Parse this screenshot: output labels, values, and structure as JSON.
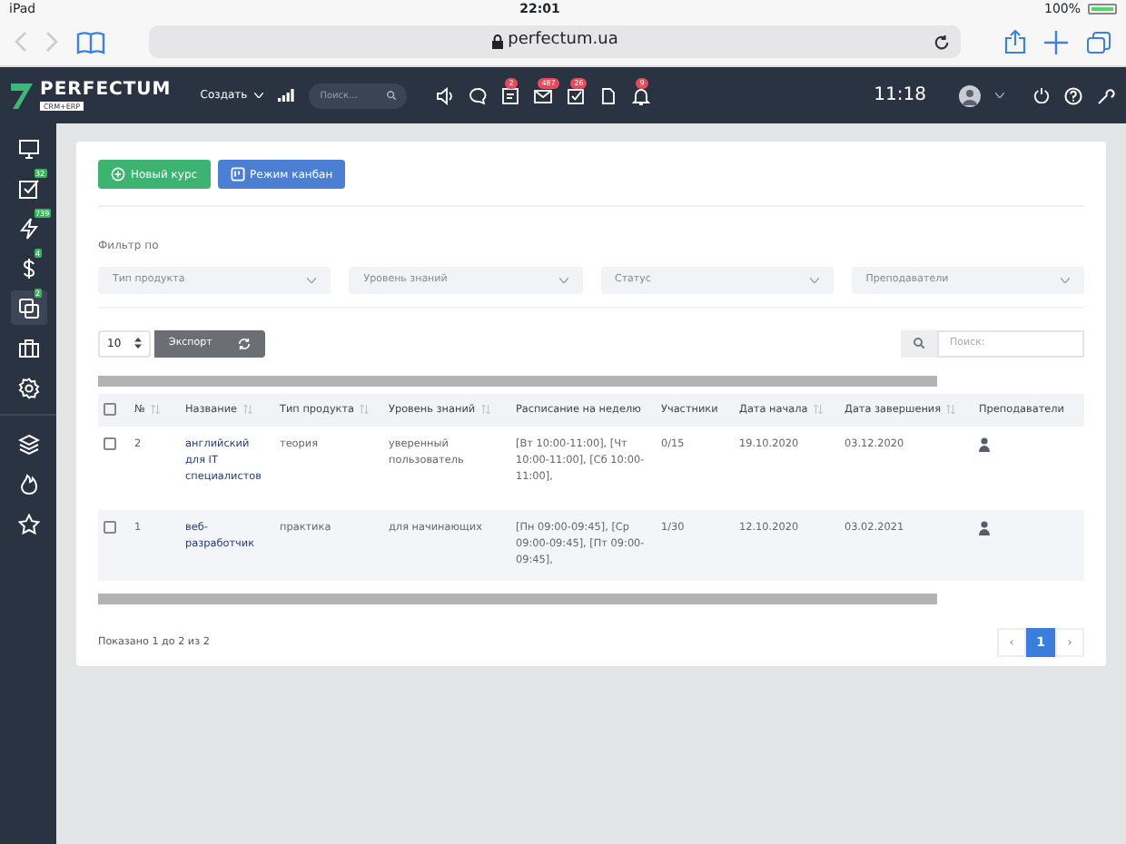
{
  "status_bar": {
    "device": "iPad",
    "time": "22:01",
    "battery": "100%"
  },
  "browser": {
    "url": "perfectum.ua"
  },
  "app_header": {
    "logo": "PERFECTUM",
    "logo_sub": "CRM+ERP",
    "create_menu": "Создать",
    "search": {
      "placeholder": "Поиск..."
    },
    "tools": [
      {
        "kind": "volume"
      },
      {
        "kind": "chat"
      },
      {
        "kind": "inbox",
        "badge": "2"
      },
      {
        "kind": "mail",
        "badge": "487"
      },
      {
        "kind": "tasks",
        "badge": "26"
      },
      {
        "kind": "document"
      },
      {
        "kind": "bell",
        "badge": "9"
      }
    ],
    "clock": "11:18"
  },
  "sidebar": {
    "groups": [
      [
        {
          "kind": "monitor",
          "selected": false
        },
        {
          "kind": "tasks",
          "badge": "32",
          "selected": false
        },
        {
          "kind": "bolt",
          "badge": "739",
          "selected": false
        },
        {
          "kind": "dollar",
          "badge": "4",
          "selected": false
        },
        {
          "kind": "copy",
          "badge": "2",
          "selected": true
        },
        {
          "kind": "briefcase",
          "selected": false
        },
        {
          "kind": "gear",
          "selected": false
        }
      ],
      [
        {
          "kind": "layers",
          "selected": false
        },
        {
          "kind": "fire",
          "selected": false
        },
        {
          "kind": "star",
          "selected": false
        }
      ]
    ]
  },
  "actions": [
    {
      "label": "Новый курс",
      "kind": "add"
    },
    {
      "label": "Режим канбан",
      "kind": "kanban"
    }
  ],
  "filters": {
    "title": "Фильтр по",
    "selects": [
      {
        "placeholder": "Тип продукта"
      },
      {
        "placeholder": "Уровень знаний"
      },
      {
        "placeholder": "Статус"
      },
      {
        "placeholder": "Преподаватели"
      }
    ]
  },
  "table_controls": {
    "page_size": "10",
    "export": "Экспорт",
    "search": {
      "placeholder": "Поиск:"
    }
  },
  "table": {
    "header_checked": false,
    "columns": [
      {
        "label": "№",
        "kind": "text",
        "sortable": true
      },
      {
        "label": "Название",
        "kind": "link",
        "sortable": true
      },
      {
        "label": "Тип продукта",
        "kind": "text",
        "sortable": true
      },
      {
        "label": "Уровень знаний",
        "kind": "text",
        "sortable": true
      },
      {
        "label": "Расписание на неделю",
        "kind": "text",
        "sortable": false
      },
      {
        "label": "Участники",
        "kind": "text",
        "sortable": false
      },
      {
        "label": "Дата начала",
        "kind": "text",
        "sortable": true
      },
      {
        "label": "Дата завершения",
        "kind": "text",
        "sortable": true
      },
      {
        "label": "Преподаватели",
        "kind": "avatar",
        "sortable": false
      }
    ],
    "rows": [
      {
        "checked": false,
        "cells": [
          "2",
          "английский для IT специалистов",
          "теория",
          "уверенный пользователь",
          "[Вт 10:00-11:00], [Чт 10:00-11:00], [Сб 10:00-11:00],",
          "0/15",
          "19.10.2020",
          "03.12.2020"
        ]
      },
      {
        "checked": false,
        "cells": [
          "1",
          "веб-разработчик",
          "практика",
          "для начинающих",
          "[Пн 09:00-09:45], [Ср 09:00-09:45], [Пт 09:00-09:45],",
          "1/30",
          "12.10.2020",
          "03.02.2021"
        ]
      }
    ]
  },
  "footer": {
    "info": "Показано 1 до 2 из 2",
    "prev": "‹",
    "next": "›",
    "pages": [
      {
        "label": "1",
        "selected": true
      }
    ]
  }
}
